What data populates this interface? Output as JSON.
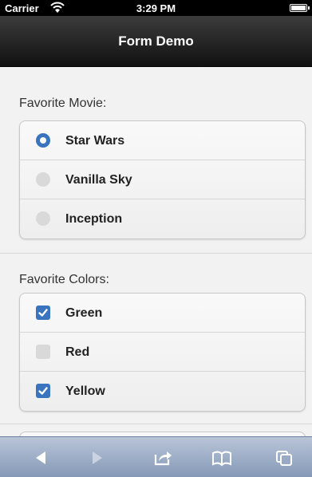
{
  "status_bar": {
    "carrier": "Carrier",
    "time": "3:29 PM"
  },
  "header": {
    "title": "Form Demo"
  },
  "movie_group": {
    "legend": "Favorite Movie:",
    "options": [
      {
        "label": "Star Wars",
        "selected": true
      },
      {
        "label": "Vanilla Sky",
        "selected": false
      },
      {
        "label": "Inception",
        "selected": false
      }
    ]
  },
  "color_group": {
    "legend": "Favorite Colors:",
    "options": [
      {
        "label": "Green",
        "checked": true
      },
      {
        "label": "Red",
        "checked": false
      },
      {
        "label": "Yellow",
        "checked": true
      }
    ]
  },
  "toolbar": {
    "icons": [
      "back-arrow-icon",
      "forward-arrow-icon",
      "share-icon",
      "bookmarks-icon",
      "tabs-icon"
    ]
  },
  "colors": {
    "accent": "#3a74bf",
    "header_bg": "#1a1a1a",
    "toolbar_bg": "#9aaac4"
  }
}
